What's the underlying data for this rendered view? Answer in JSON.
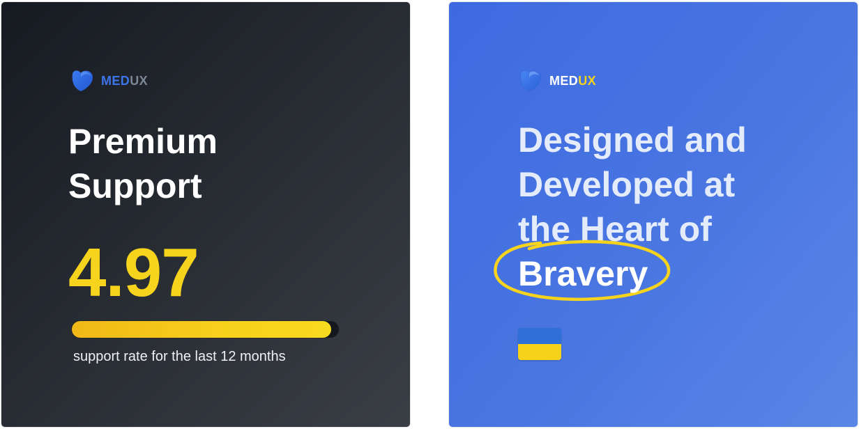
{
  "left_card": {
    "logo": {
      "med": "MED",
      "ux": "UX"
    },
    "title_line1": "Premium",
    "title_line2": "Support",
    "rating": "4.97",
    "rating_fill": 0.97,
    "caption": "support rate for the last 12 months"
  },
  "right_card": {
    "logo": {
      "med": "MED",
      "ux": "UX"
    },
    "title_line1": "Designed and",
    "title_line2": "Developed at",
    "title_line3": "the Heart of",
    "title_highlight": "Bravery",
    "flag": "ukraine-flag-icon"
  },
  "colors": {
    "accent_yellow": "#f6d31c",
    "brand_blue": "#3e74ea",
    "dark_bg": "#1e2229"
  }
}
